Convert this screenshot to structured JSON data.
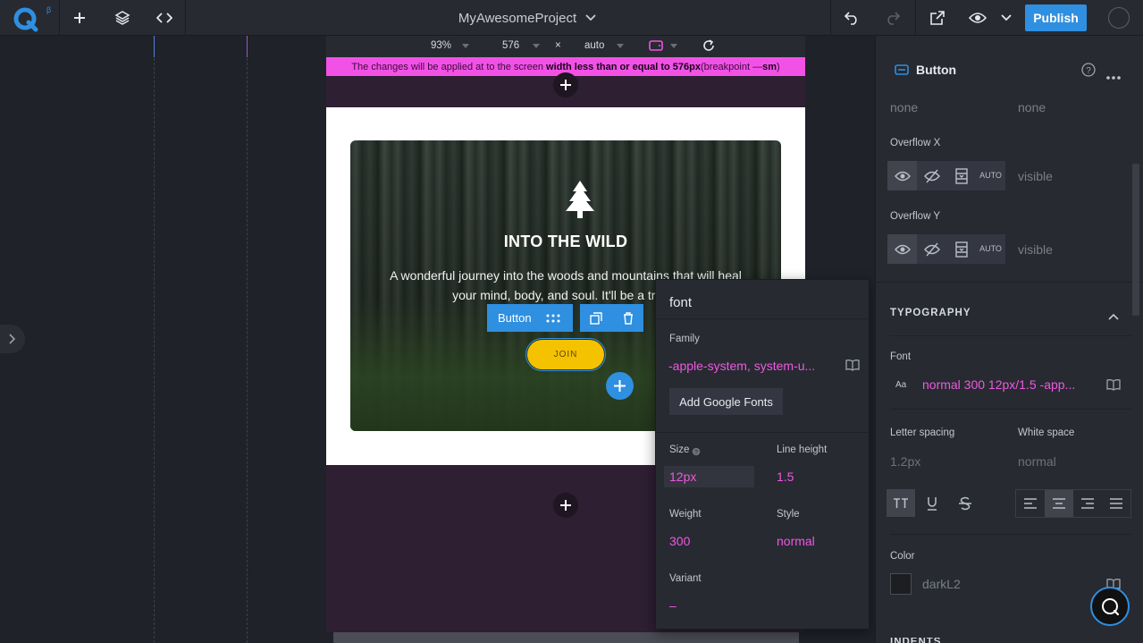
{
  "app": {
    "logo_superscript": "β",
    "project_name": "MyAwesomeProject",
    "publish_label": "Publish"
  },
  "sizebar": {
    "zoom": "93%",
    "width": "576",
    "times": "×",
    "height": "auto"
  },
  "banner": {
    "prefix": "The changes will be applied at to the screen ",
    "bold": "width less than or equal to 576px",
    "middle": " (breakpoint — ",
    "breakpoint": "sm",
    "suffix": ")"
  },
  "card": {
    "title": "INTO THE WILD",
    "description": "A wonderful journey into the woods and mountains that will heal your mind, body, and soul. It'll be a trip to",
    "button_label": "JOIN"
  },
  "element_toolbar": {
    "label": "Button"
  },
  "font_popup": {
    "title": "font",
    "family_label": "Family",
    "family_value": "-apple-system, system-u...",
    "add_fonts_label": "Add Google Fonts",
    "size_label": "Size",
    "size_value": "12px",
    "line_height_label": "Line height",
    "line_height_value": "1.5",
    "weight_label": "Weight",
    "weight_value": "300",
    "style_label": "Style",
    "style_value": "normal",
    "variant_label": "Variant",
    "variant_value": "–"
  },
  "right_panel": {
    "component_name": "Button",
    "none_left": "none",
    "none_right": "none",
    "overflow_x_label": "Overflow X",
    "overflow_x_value": "visible",
    "overflow_y_label": "Overflow Y",
    "overflow_y_value": "visible",
    "overflow_auto_top": "AU",
    "overflow_auto_bottom": "TO",
    "typography_heading": "TYPOGRAPHY",
    "font_label": "Font",
    "font_prefix": "Aa",
    "font_value": "normal 300 12px/1.5 -app...",
    "letter_spacing_label": "Letter spacing",
    "letter_spacing_value": "1.2px",
    "white_space_label": "White space",
    "white_space_value": "normal",
    "color_label": "Color",
    "color_value": "darkL2",
    "next_section": "INDENTS"
  },
  "colors": {
    "accent": "#2f8fe0",
    "breakpoint_pink": "#f251e6",
    "value_pink": "#ef58e2",
    "join_yellow": "#f5c200"
  },
  "icons": [
    "logo-icon",
    "plus-icon",
    "layers-icon",
    "code-icon",
    "chevron-down-icon",
    "undo-icon",
    "redo-icon",
    "external-link-icon",
    "eye-icon",
    "refresh-icon",
    "tree-icon",
    "drag-icon",
    "duplicate-icon",
    "trash-icon",
    "book-icon",
    "help-icon",
    "more-icon",
    "eye-slash-icon",
    "scroll-icon",
    "underline-icon",
    "strikethrough-icon",
    "align-left-icon",
    "align-center-icon",
    "align-right-icon",
    "align-justify-icon",
    "chevron-up-icon",
    "chat-icon",
    "chevron-right-icon"
  ]
}
